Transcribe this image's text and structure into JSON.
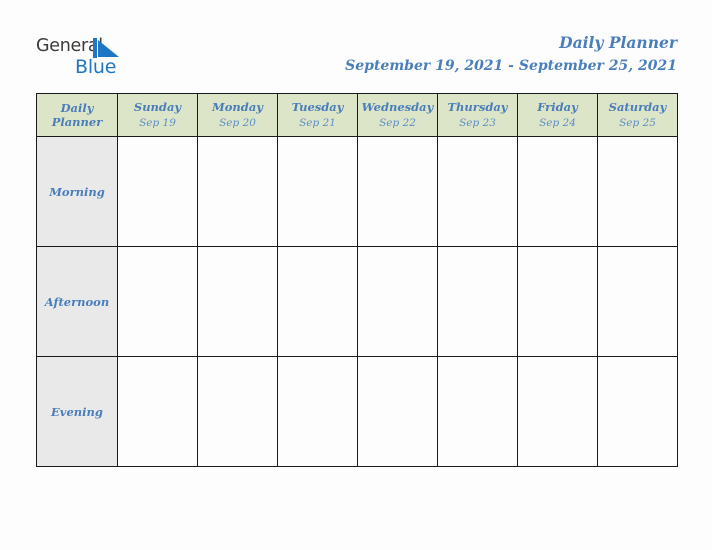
{
  "logo": {
    "word_one": "General",
    "word_two": "Blue",
    "mark": "blue-triangle-flag",
    "word_one_color": "#3b3b3b",
    "word_two_color": "#1f76c4"
  },
  "header": {
    "title": "Daily Planner",
    "date_range": "September 19, 2021 - September 25, 2021",
    "title_color": "#4a7ebb"
  },
  "table": {
    "corner_label_line1": "Daily",
    "corner_label_line2": "Planner",
    "header_bg": "#dde5c8",
    "label_bg": "#e9e9e9",
    "border_color": "#1a1a1a",
    "days": [
      {
        "name": "Sunday",
        "date": "Sep 19"
      },
      {
        "name": "Monday",
        "date": "Sep 20"
      },
      {
        "name": "Tuesday",
        "date": "Sep 21"
      },
      {
        "name": "Wednesday",
        "date": "Sep 22"
      },
      {
        "name": "Thursday",
        "date": "Sep 23"
      },
      {
        "name": "Friday",
        "date": "Sep 24"
      },
      {
        "name": "Saturday",
        "date": "Sep 25"
      }
    ],
    "periods": [
      {
        "label": "Morning",
        "entries": [
          "",
          "",
          "",
          "",
          "",
          "",
          ""
        ]
      },
      {
        "label": "Afternoon",
        "entries": [
          "",
          "",
          "",
          "",
          "",
          "",
          ""
        ]
      },
      {
        "label": "Evening",
        "entries": [
          "",
          "",
          "",
          "",
          "",
          "",
          ""
        ]
      }
    ]
  }
}
